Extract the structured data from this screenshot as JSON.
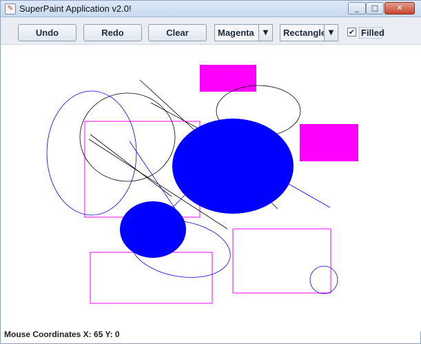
{
  "window": {
    "title": "SuperPaint Application v2.0!",
    "minimize_glyph": "_",
    "maximize_glyph": "□",
    "close_glyph": "✕",
    "app_icon": "paint-icon"
  },
  "toolbar": {
    "undo_label": "Undo",
    "redo_label": "Redo",
    "clear_label": "Clear",
    "color_select": {
      "value": "Magenta"
    },
    "shape_select": {
      "value": "Rectangle"
    },
    "filled": {
      "label": "Filled",
      "checked": true
    }
  },
  "status": {
    "text": "Mouse Coordinates X: 65 Y: 0"
  },
  "colors": {
    "magenta": "#ff00ff",
    "blue": "#0000ff",
    "black": "#000000"
  }
}
